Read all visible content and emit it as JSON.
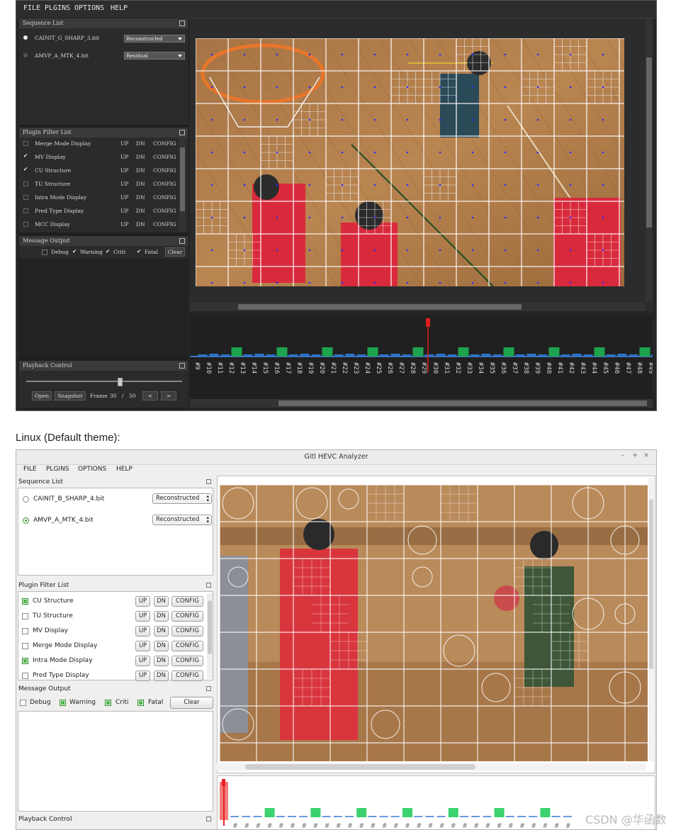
{
  "dark_app": {
    "menu": [
      "FILE",
      "PLGINS",
      "OPTIONS",
      "HELP"
    ],
    "sequence_list": {
      "title": "Sequence List",
      "items": [
        {
          "name": "CAINIT_G_SHARP_3.bit",
          "mode": "Reconstructed",
          "selected": true
        },
        {
          "name": "AMVP_A_MTK_4.bit",
          "mode": "Residual",
          "selected": false
        }
      ]
    },
    "plugin_filter_list": {
      "title": "Plugin Filter List",
      "items": [
        {
          "label": "Merge Mode Display",
          "checked": false
        },
        {
          "label": "MV Display",
          "checked": true
        },
        {
          "label": "CU Structure",
          "checked": true
        },
        {
          "label": "TU Structure",
          "checked": false
        },
        {
          "label": "Intra Mode Display",
          "checked": false
        },
        {
          "label": "Pred Type Display",
          "checked": false
        },
        {
          "label": "MCC Display",
          "checked": false
        }
      ],
      "up": "UP",
      "dn": "DN",
      "config": "CONFIG"
    },
    "message_output": {
      "title": "Message Output",
      "filters": [
        {
          "label": "Debug",
          "checked": false
        },
        {
          "label": "Warning",
          "checked": true
        },
        {
          "label": "Criti",
          "checked": true
        },
        {
          "label": "Fatal",
          "checked": true
        }
      ],
      "clear": "Clear"
    },
    "playback": {
      "title": "Playback Control",
      "open": "Open",
      "snapshot": "Snapshot",
      "frame_label": "Frame",
      "frame": "30",
      "separator": "/",
      "total": "50",
      "prev": "<",
      "next": ">",
      "slider_fraction": 0.6
    },
    "timeline": {
      "first_frame": 9,
      "last_frame": 49,
      "current_frame": 29,
      "label_prefix": "#",
      "intra_color": "#1ea34e",
      "inter_color": "#2b74c7",
      "cursor_color": "#e01b1b"
    }
  },
  "caption": "Linux (Default theme):",
  "light_app": {
    "window_title": "Gitl HEVC Analyzer",
    "window_controls": [
      "–",
      "+",
      "×"
    ],
    "menu": [
      "FILE",
      "PLGINS",
      "OPTIONS",
      "HELP"
    ],
    "sequence_list": {
      "title": "Sequence List",
      "items": [
        {
          "name": "CAINIT_B_SHARP_4.bit",
          "mode": "Reconstructed",
          "selected": false
        },
        {
          "name": "AMVP_A_MTK_4.bit",
          "mode": "Reconstructed",
          "selected": true
        }
      ]
    },
    "plugin_filter_list": {
      "title": "Plugin Filter List",
      "items": [
        {
          "label": "CU Structure",
          "checked": true
        },
        {
          "label": "TU Structure",
          "checked": false
        },
        {
          "label": "MV Display",
          "checked": false
        },
        {
          "label": "Merge Mode Display",
          "checked": false
        },
        {
          "label": "Intra Mode Display",
          "checked": true
        },
        {
          "label": "Pred Type Display",
          "checked": false
        }
      ],
      "up": "UP",
      "dn": "DN",
      "config": "CONFIG"
    },
    "message_output": {
      "title": "Message Output",
      "filters": [
        {
          "label": "Debug",
          "checked": false
        },
        {
          "label": "Warning",
          "checked": true
        },
        {
          "label": "Criti",
          "checked": true
        },
        {
          "label": "Fatal",
          "checked": true
        }
      ],
      "clear": "Clear"
    },
    "playback": {
      "title": "Playback Control"
    },
    "timeline": {
      "bar_count": 30,
      "label": "#"
    }
  },
  "watermark": "CSDN @华函数"
}
